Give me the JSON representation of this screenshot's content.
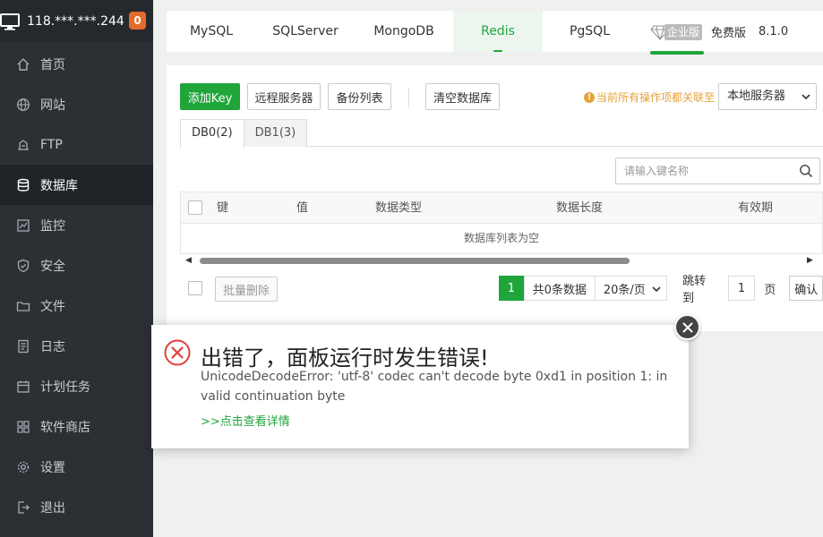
{
  "server": {
    "ip": "118.***.***.244",
    "badge": "0"
  },
  "nav": [
    {
      "label": "首页",
      "icon": "home-icon"
    },
    {
      "label": "网站",
      "icon": "globe-icon"
    },
    {
      "label": "FTP",
      "icon": "ftp-icon"
    },
    {
      "label": "数据库",
      "icon": "database-icon",
      "active": true
    },
    {
      "label": "监控",
      "icon": "monitor-chart-icon"
    },
    {
      "label": "安全",
      "icon": "shield-icon"
    },
    {
      "label": "文件",
      "icon": "folder-icon"
    },
    {
      "label": "日志",
      "icon": "log-icon"
    },
    {
      "label": "计划任务",
      "icon": "calendar-icon"
    },
    {
      "label": "软件商店",
      "icon": "apps-grid-icon"
    },
    {
      "label": "设置",
      "icon": "gear-icon"
    },
    {
      "label": "退出",
      "icon": "logout-icon"
    }
  ],
  "db_tabs": [
    "MySQL",
    "SQLServer",
    "MongoDB",
    "Redis",
    "PgSQL"
  ],
  "active_db_tab": "Redis",
  "edition": {
    "enterprise": "企业版",
    "free": "免费版",
    "version": "8.1.0"
  },
  "toolbar": {
    "add_key": "添加Key",
    "remote_server": "远程服务器",
    "backup_list": "备份列表",
    "clear_db": "清空数据库",
    "notice": "当前所有操作项都关联至",
    "server_select": "本地服务器"
  },
  "subtabs": [
    "DB0(2)",
    "DB1(3)"
  ],
  "search": {
    "placeholder": "请输入键名称"
  },
  "table": {
    "headers": [
      "键",
      "值",
      "数据类型",
      "数据长度",
      "有效期"
    ],
    "empty_text": "数据库列表为空"
  },
  "footer": {
    "batch_delete": "批量删除",
    "current_page": "1",
    "total": "共0条数据",
    "per_page": "20条/页",
    "jump_to": "跳转到",
    "jump_value": "1",
    "page_unit": "页",
    "confirm": "确认"
  },
  "dialog": {
    "title": "出错了，面板运行时发生错误!",
    "message": "UnicodeDecodeError: 'utf-8' codec can't decode byte 0xd1 in position 1: invalid continuation byte",
    "link": ">>点击查看详情"
  },
  "colors": {
    "accent": "#20a53a",
    "sidebar": "#2c3035",
    "error": "#e0413a",
    "warning": "#e6a23c",
    "badge": "#e36c2b"
  }
}
